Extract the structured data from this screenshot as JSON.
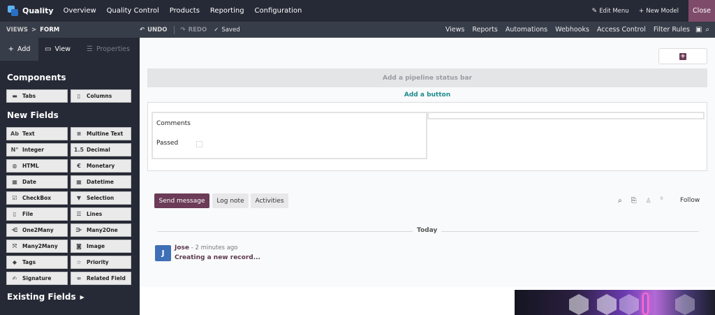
{
  "topbar": {
    "app_name": "Quality",
    "menu": [
      "Overview",
      "Quality Control",
      "Products",
      "Reporting",
      "Configuration"
    ],
    "edit_menu": "Edit Menu",
    "new_model": "New Model",
    "close": "Close"
  },
  "subbar": {
    "breadcrumb_root": "VIEWS",
    "breadcrumb_current": "FORM",
    "undo": "UNDO",
    "redo": "REDO",
    "saved": "Saved",
    "nav": [
      "Views",
      "Reports",
      "Automations",
      "Webhooks",
      "Access Control",
      "Filter Rules"
    ]
  },
  "sidebar": {
    "tabs": {
      "add": "Add",
      "view": "View",
      "properties": "Properties"
    },
    "components_heading": "Components",
    "components": [
      {
        "label": "Tabs",
        "icon": "tabs-icon"
      },
      {
        "label": "Columns",
        "icon": "columns-icon"
      }
    ],
    "new_fields_heading": "New Fields",
    "new_fields": [
      {
        "label": "Text",
        "icon": "Ab"
      },
      {
        "label": "Multine Text",
        "icon": "multiline-icon"
      },
      {
        "label": "Integer",
        "icon": "N°"
      },
      {
        "label": "Decimal",
        "icon": "1.5"
      },
      {
        "label": "HTML",
        "icon": "globe-icon"
      },
      {
        "label": "Monetary",
        "icon": "euro-icon"
      },
      {
        "label": "Date",
        "icon": "calendar-icon"
      },
      {
        "label": "Datetime",
        "icon": "calendar-clock-icon"
      },
      {
        "label": "CheckBox",
        "icon": "checkbox-icon"
      },
      {
        "label": "Selection",
        "icon": "caret-down-icon"
      },
      {
        "label": "File",
        "icon": "file-icon"
      },
      {
        "label": "Lines",
        "icon": "lines-icon"
      },
      {
        "label": "One2Many",
        "icon": "one2many-icon"
      },
      {
        "label": "Many2One",
        "icon": "many2one-icon"
      },
      {
        "label": "Many2Many",
        "icon": "many2many-icon"
      },
      {
        "label": "Image",
        "icon": "camera-icon"
      },
      {
        "label": "Tags",
        "icon": "tag-icon"
      },
      {
        "label": "Priority",
        "icon": "star-icon"
      },
      {
        "label": "Signature",
        "icon": "signature-icon"
      },
      {
        "label": "Related Field",
        "icon": "link-icon"
      }
    ],
    "existing_fields_heading": "Existing Fields"
  },
  "form": {
    "pipeline": "Add a pipeline status bar",
    "add_button": "Add a button",
    "fields": {
      "comments": "Comments",
      "passed": "Passed"
    }
  },
  "chatter": {
    "send_message": "Send message",
    "log_note": "Log note",
    "activities": "Activities",
    "follower_count": "0",
    "follow": "Follow",
    "date_separator": "Today",
    "message": {
      "avatar_letter": "J",
      "author": "Jose",
      "time": " - 2 minutes ago",
      "body": "Creating a new record..."
    }
  },
  "colors": {
    "navbar": "#262a36",
    "accent": "#6b3b57",
    "link": "#1f8a8e",
    "avatar": "#3e6fb7"
  }
}
